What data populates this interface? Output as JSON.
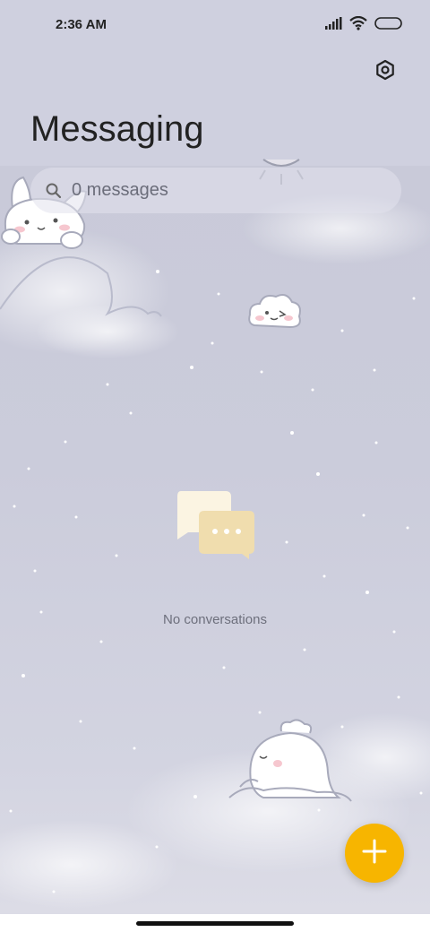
{
  "status_bar": {
    "time": "2:36 AM",
    "icons": [
      "signal-icon",
      "wifi-icon",
      "battery-icon"
    ]
  },
  "header": {
    "title": "Messaging",
    "settings_icon": "gear-icon"
  },
  "search": {
    "placeholder": "0 messages",
    "icon": "search-icon"
  },
  "empty_state": {
    "icon": "chat-bubbles-icon",
    "text": "No conversations"
  },
  "fab": {
    "icon": "plus-icon",
    "color": "#f7b500"
  },
  "colors": {
    "background": "#cfd0df",
    "accent": "#f7b500",
    "text": "#222222",
    "secondary_text": "#6d6f7c"
  }
}
